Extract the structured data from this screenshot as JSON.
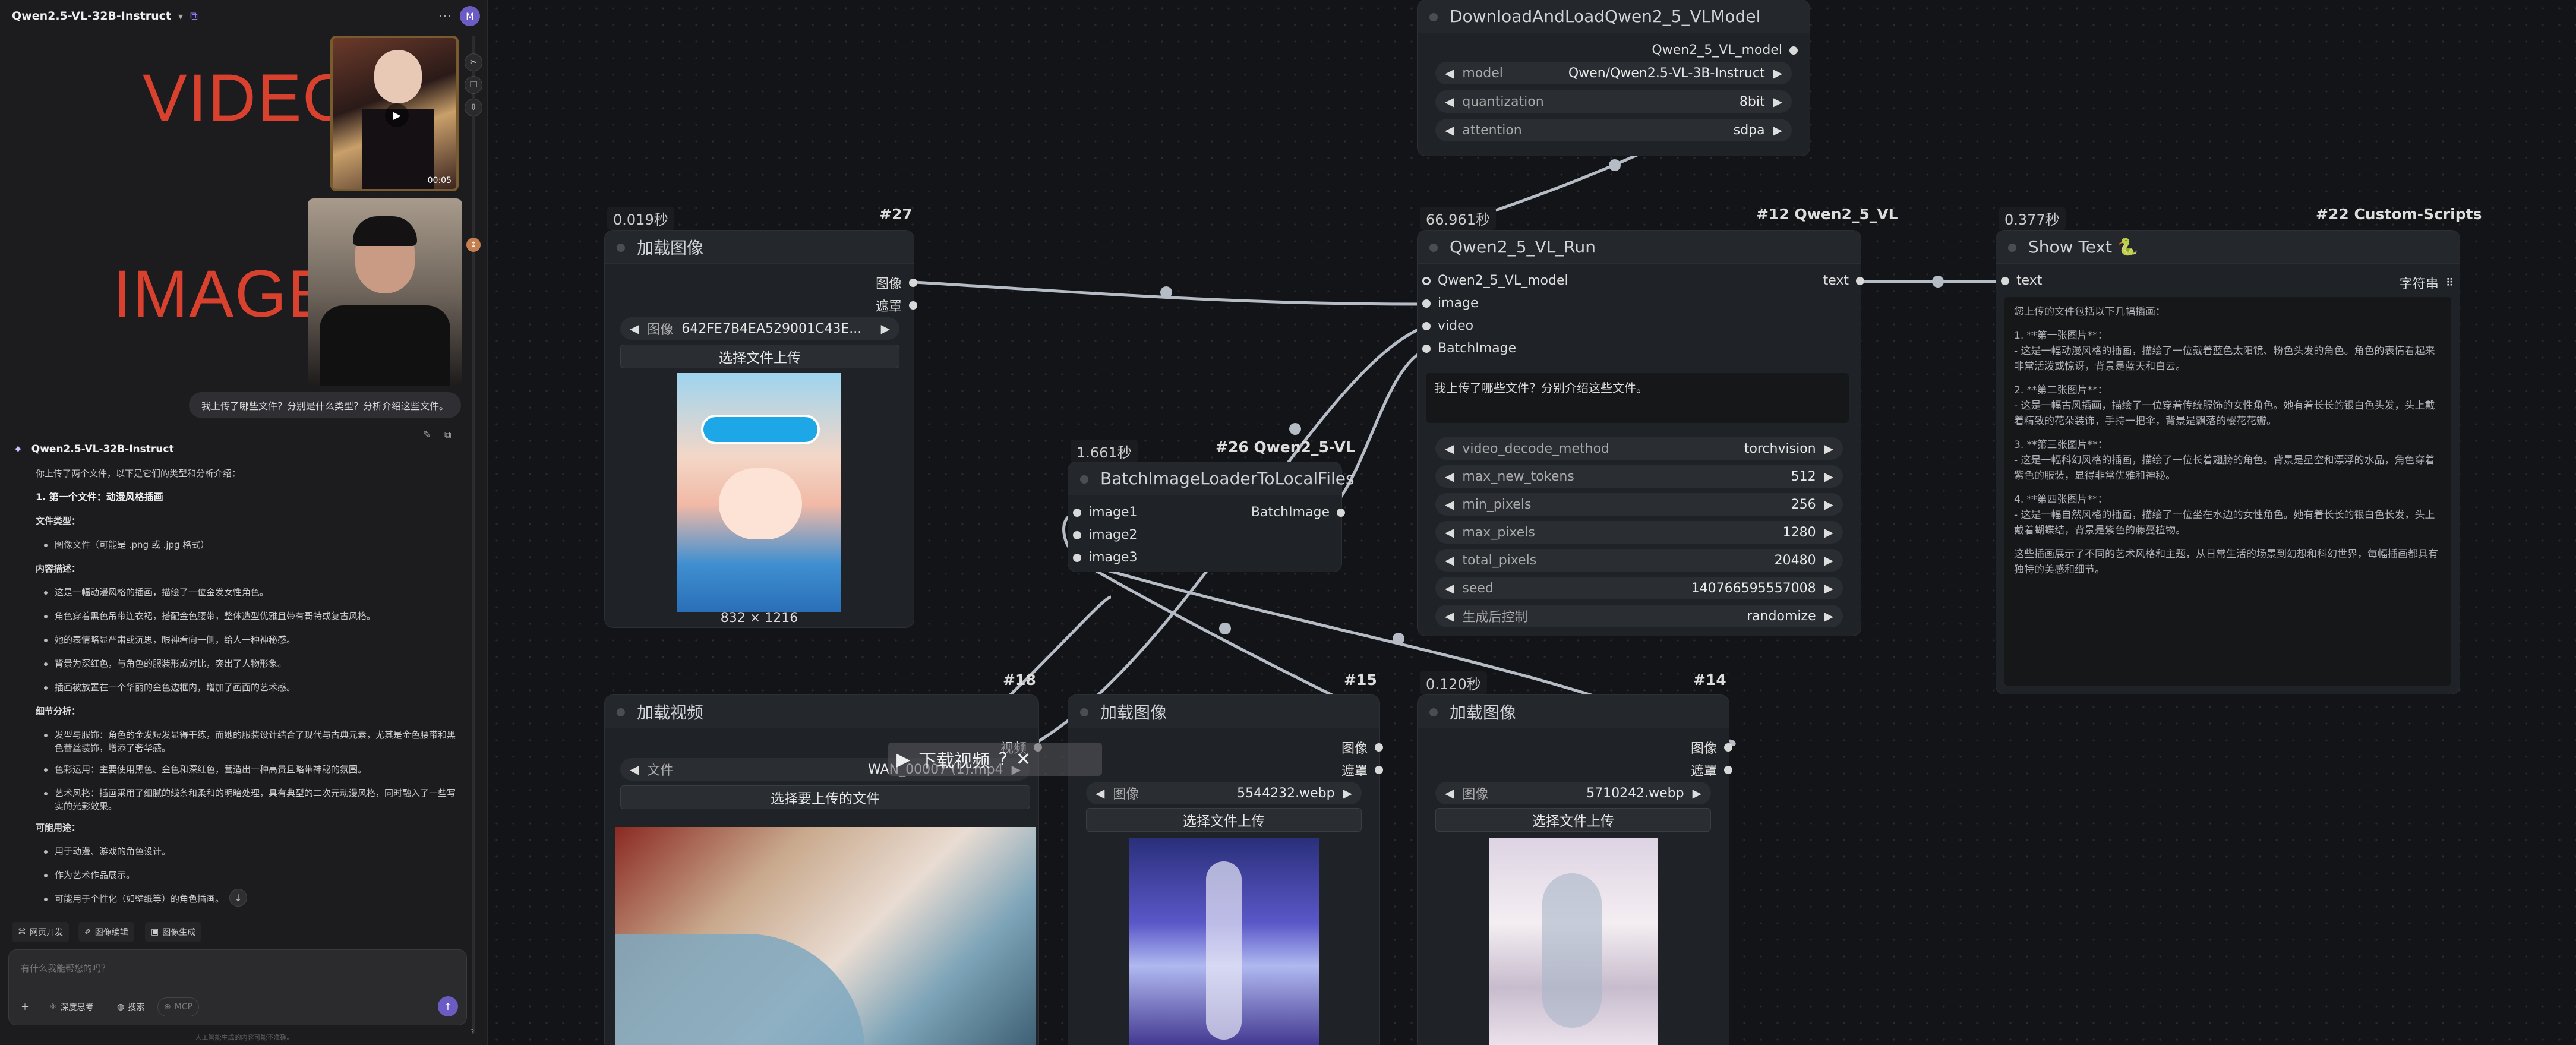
{
  "sidebar": {
    "model_name": "Qwen2.5-VL-32B-Instruct",
    "avatar": "M",
    "video_label": "VIDEO",
    "image_label": "IMAGE",
    "video_duration": "00:05",
    "user_message": "我上传了哪些文件？分别是什么类型？分析介绍这些文件。",
    "answer_model": "Qwen2.5-VL-32B-Instruct",
    "answer_lines": [
      {
        "kind": "p",
        "text": "你上传了两个文件，以下是它们的类型和分析介绍："
      },
      {
        "kind": "b",
        "text": "1. 第一个文件：动漫风格插画"
      },
      {
        "kind": "h",
        "text": "文件类型："
      },
      {
        "kind": "li",
        "text": "图像文件（可能是 .png 或 .jpg 格式）"
      },
      {
        "kind": "h",
        "text": "内容描述："
      },
      {
        "kind": "li",
        "text": "这是一幅动漫风格的插画，描绘了一位金发女性角色。"
      },
      {
        "kind": "li",
        "text": "角色穿着黑色吊带连衣裙，搭配金色腰带，整体造型优雅且带有哥特或复古风格。"
      },
      {
        "kind": "li",
        "text": "她的表情略显严肃或沉思，眼神看向一侧，给人一种神秘感。"
      },
      {
        "kind": "li",
        "text": "背景为深红色，与角色的服装形成对比，突出了人物形象。"
      },
      {
        "kind": "li",
        "text": "插画被放置在一个华丽的金色边框内，增加了画面的艺术感。"
      },
      {
        "kind": "h",
        "text": "细节分析："
      },
      {
        "kind": "li",
        "text": "发型与服饰：角色的金发短发显得干练，而她的服装设计结合了现代与古典元素，尤其是金色腰带和黑色蕾丝装饰，增添了奢华感。"
      },
      {
        "kind": "li",
        "text": "色彩运用：主要使用黑色、金色和深红色，营造出一种高贵且略带神秘的氛围。"
      },
      {
        "kind": "li",
        "text": "艺术风格：插画采用了细腻的线条和柔和的明暗处理，具有典型的二次元动漫风格，同时融入了一些写实的光影效果。"
      },
      {
        "kind": "h",
        "text": "可能用途："
      },
      {
        "kind": "li",
        "text": "用于动漫、游戏的角色设计。"
      },
      {
        "kind": "li",
        "text": "作为艺术作品展示。"
      },
      {
        "kind": "li",
        "text": "可能用于个性化（如壁纸等）的角色插画。"
      }
    ],
    "quick_actions": [
      "网页开发",
      "图像编辑",
      "图像生成"
    ],
    "input_placeholder": "有什么我能帮您的吗？",
    "btn_deep": "深度思考",
    "btn_search": "搜索",
    "btn_mcp": "MCP",
    "footnote": "人工智能生成的内容可能不准确。"
  },
  "nodes": {
    "download": {
      "title": "DownloadAndLoadQwen2_5_VLModel",
      "output": "Qwen2_5_VL_model",
      "widgets": [
        {
          "label": "model",
          "value": "Qwen/Qwen2.5-VL-3B-Instruct"
        },
        {
          "label": "quantization",
          "value": "8bit"
        },
        {
          "label": "attention",
          "value": "sdpa"
        }
      ]
    },
    "load27": {
      "id": "#27",
      "time": "0.019秒",
      "title": "加载图像",
      "outputs": [
        "图像",
        "遮罩"
      ],
      "widget": {
        "label": "图像",
        "value": "642FE7B4EA529001C43E..."
      },
      "upload": "选择文件上传",
      "caption": "832 × 1216"
    },
    "run": {
      "id": "#12 Qwen2_5_VL",
      "time": "66.961秒",
      "title": "Qwen2_5_VL_Run",
      "inputs": [
        "Qwen2_5_VL_model",
        "image",
        "video",
        "BatchImage"
      ],
      "output": "text",
      "prompt": "我上传了哪些文件？分别介绍这些文件。",
      "widgets": [
        {
          "label": "video_decode_method",
          "value": "torchvision"
        },
        {
          "label": "max_new_tokens",
          "value": "512"
        },
        {
          "label": "min_pixels",
          "value": "256"
        },
        {
          "label": "max_pixels",
          "value": "1280"
        },
        {
          "label": "total_pixels",
          "value": "20480"
        },
        {
          "label": "seed",
          "value": "140766595557008"
        },
        {
          "label": "生成后控制",
          "value": "randomize"
        }
      ]
    },
    "show": {
      "id": "#22 Custom-Scripts",
      "time": "0.377秒",
      "title": "Show Text 🐍",
      "input": "text",
      "output": "字符串",
      "lines": [
        "您上传的文件包括以下几幅插画：",
        "",
        "1. **第一张图片**：",
        "   - 这是一幅动漫风格的插画，描绘了一位戴着蓝色太阳镜、粉色头发的角色。角色的表情看起来非常活泼或惊讶，背景是蓝天和白云。",
        "",
        "2. **第二张图片**：",
        "   - 这是一幅古风插画，描绘了一位穿着传统服饰的女性角色。她有着长长的银白色头发，头上戴着精致的花朵装饰，手持一把伞，背景是飘落的樱花花瓣。",
        "",
        "3. **第三张图片**：",
        "   - 这是一幅科幻风格的插画，描绘了一位长着翅膀的角色。背景是星空和漂浮的水晶，角色穿着紫色的服装，显得非常优雅和神秘。",
        "",
        "4. **第四张图片**：",
        "   - 这是一幅自然风格的插画，描绘了一位坐在水边的女性角色。她有着长长的银白色长发，头上戴着蝴蝶结，背景是紫色的藤蔓植物。",
        "",
        "这些插画展示了不同的艺术风格和主题，从日常生活的场景到幻想和科幻世界，每幅插画都具有独特的美感和细节。"
      ]
    },
    "batch": {
      "id": "#26 Qwen2_5-VL",
      "time": "1.661秒",
      "title": "BatchImageLoaderToLocalFiles",
      "inputs": [
        "image1",
        "image2",
        "image3"
      ],
      "output": "BatchImage"
    },
    "video18": {
      "id": "#18",
      "title": "加载视频",
      "output": "视频",
      "widget": {
        "label": "文件",
        "value": "WAN_00007 (1).mp4"
      },
      "upload": "选择要上传的文件"
    },
    "load15": {
      "id": "#15",
      "title": "加载图像",
      "outputs": [
        "图像",
        "遮罩"
      ],
      "widget": {
        "label": "图像",
        "value": "5544232.webp"
      },
      "upload": "选择文件上传"
    },
    "load14": {
      "id": "#14",
      "time": "0.120秒",
      "title": "加载图像",
      "outputs": [
        "图像",
        "遮罩"
      ],
      "widget": {
        "label": "图像",
        "value": "5710242.webp"
      },
      "upload": "选择文件上传"
    }
  },
  "overlay_text": "下载视频",
  "colors": {
    "accent": "#6b5cc4",
    "video_label": "#d9412f",
    "wire": "#b6bcc6"
  }
}
